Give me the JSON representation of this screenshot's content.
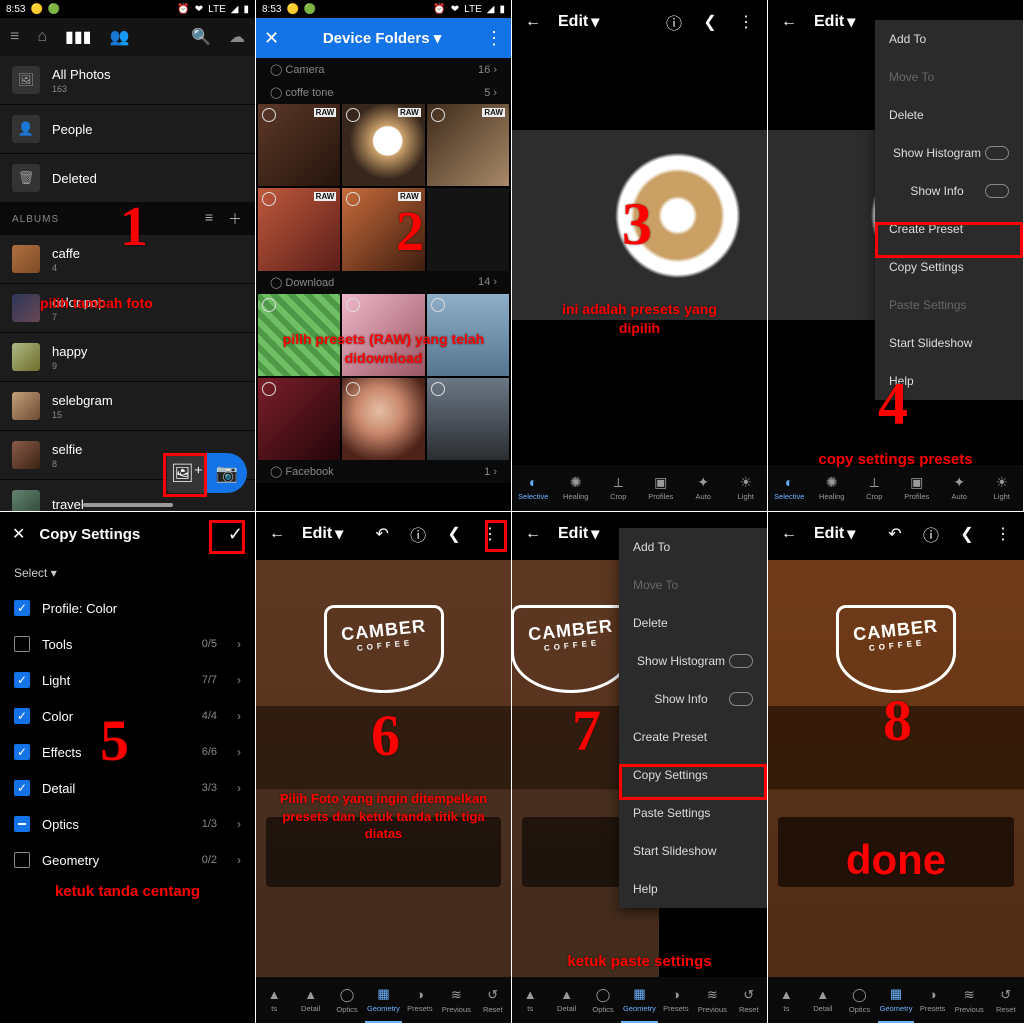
{
  "status": {
    "time": "8:53",
    "net": "LTE",
    "icons_left": [
      "🕒",
      "🟡",
      "🟢"
    ],
    "icons_right": [
      "⏰",
      "❤︎",
      "📶",
      "◢",
      "▮"
    ]
  },
  "panel1": {
    "step": "1",
    "annotation": "pilih tambah foto",
    "rows": {
      "allphotos": {
        "label": "All Photos",
        "count": "163"
      },
      "people": {
        "label": "People"
      },
      "deleted": {
        "label": "Deleted"
      }
    },
    "albums_header": "ALBUMS",
    "albums": [
      {
        "label": "caffe",
        "count": "4"
      },
      {
        "label": "color pop",
        "count": "7"
      },
      {
        "label": "happy",
        "count": "9"
      },
      {
        "label": "selebgram",
        "count": "15"
      },
      {
        "label": "selfie",
        "count": "8"
      },
      {
        "label": "travel",
        "count": ""
      }
    ]
  },
  "panel2": {
    "step": "2",
    "title": "Device Folders",
    "annotation": "pilih presets (RAW) yang telah didownload",
    "folders": {
      "camera": {
        "label": "Camera",
        "count": "16"
      },
      "coffe": {
        "label": "coffe tone",
        "count": "5"
      },
      "download": {
        "label": "Download",
        "count": "14"
      },
      "facebook": {
        "label": "Facebook",
        "count": "1"
      }
    },
    "raw_badge": "RAW"
  },
  "panel3": {
    "step": "3",
    "edit": "Edit",
    "annotation": "ini adalah presets yang dipilih",
    "tools": [
      "Selective",
      "Healing",
      "Crop",
      "Profiles",
      "Auto",
      "Light"
    ]
  },
  "panel4": {
    "step": "4",
    "edit": "Edit",
    "annotation": "copy settings presets",
    "tools": [
      "Selective",
      "Healing",
      "Crop",
      "Profiles",
      "Auto",
      "Light"
    ],
    "menu": [
      "Add To",
      "Move To",
      "Delete",
      "Show Histogram",
      "Show Info",
      "Create Preset",
      "Copy Settings",
      "Paste Settings",
      "Start Slideshow",
      "Help"
    ]
  },
  "panel5": {
    "step": "5",
    "title": "Copy Settings",
    "select": "Select",
    "annotation": "ketuk tanda centang",
    "options": [
      {
        "label": "Profile: Color",
        "checked": "on",
        "count": ""
      },
      {
        "label": "Tools",
        "checked": "off",
        "count": "0/5"
      },
      {
        "label": "Light",
        "checked": "on",
        "count": "7/7"
      },
      {
        "label": "Color",
        "checked": "on",
        "count": "4/4"
      },
      {
        "label": "Effects",
        "checked": "on",
        "count": "6/6"
      },
      {
        "label": "Detail",
        "checked": "on",
        "count": "3/3"
      },
      {
        "label": "Optics",
        "checked": "semi",
        "count": "1/3"
      },
      {
        "label": "Geometry",
        "checked": "off",
        "count": "0/2"
      }
    ]
  },
  "panel6": {
    "step": "6",
    "edit": "Edit",
    "annotation": "Pilih Foto yang ingin ditempelkan presets dan ketuk tanda titik tiga diatas",
    "camber": {
      "big": "CAMBER",
      "small": "COFFEE"
    },
    "tools": [
      "ts",
      "Detail",
      "Optics",
      "Geometry",
      "Presets",
      "Previous",
      "Reset"
    ]
  },
  "panel7": {
    "step": "7",
    "edit": "Edit",
    "annotation": "ketuk paste settings",
    "camber": {
      "big": "CAMBER",
      "small": "COFFEE"
    },
    "menu": [
      "Add To",
      "Move To",
      "Delete",
      "Show Histogram",
      "Show Info",
      "Create Preset",
      "Copy Settings",
      "Paste Settings",
      "Start Slideshow",
      "Help"
    ],
    "tools": [
      "ts",
      "Detail",
      "Optics",
      "Geometry",
      "Presets",
      "Previous",
      "Reset"
    ]
  },
  "panel8": {
    "step": "8",
    "edit": "Edit",
    "annotation": "done",
    "camber": {
      "big": "CAMBER",
      "small": "COFFEE"
    },
    "tools": [
      "ts",
      "Detail",
      "Optics",
      "Geometry",
      "Presets",
      "Previous",
      "Reset"
    ]
  }
}
